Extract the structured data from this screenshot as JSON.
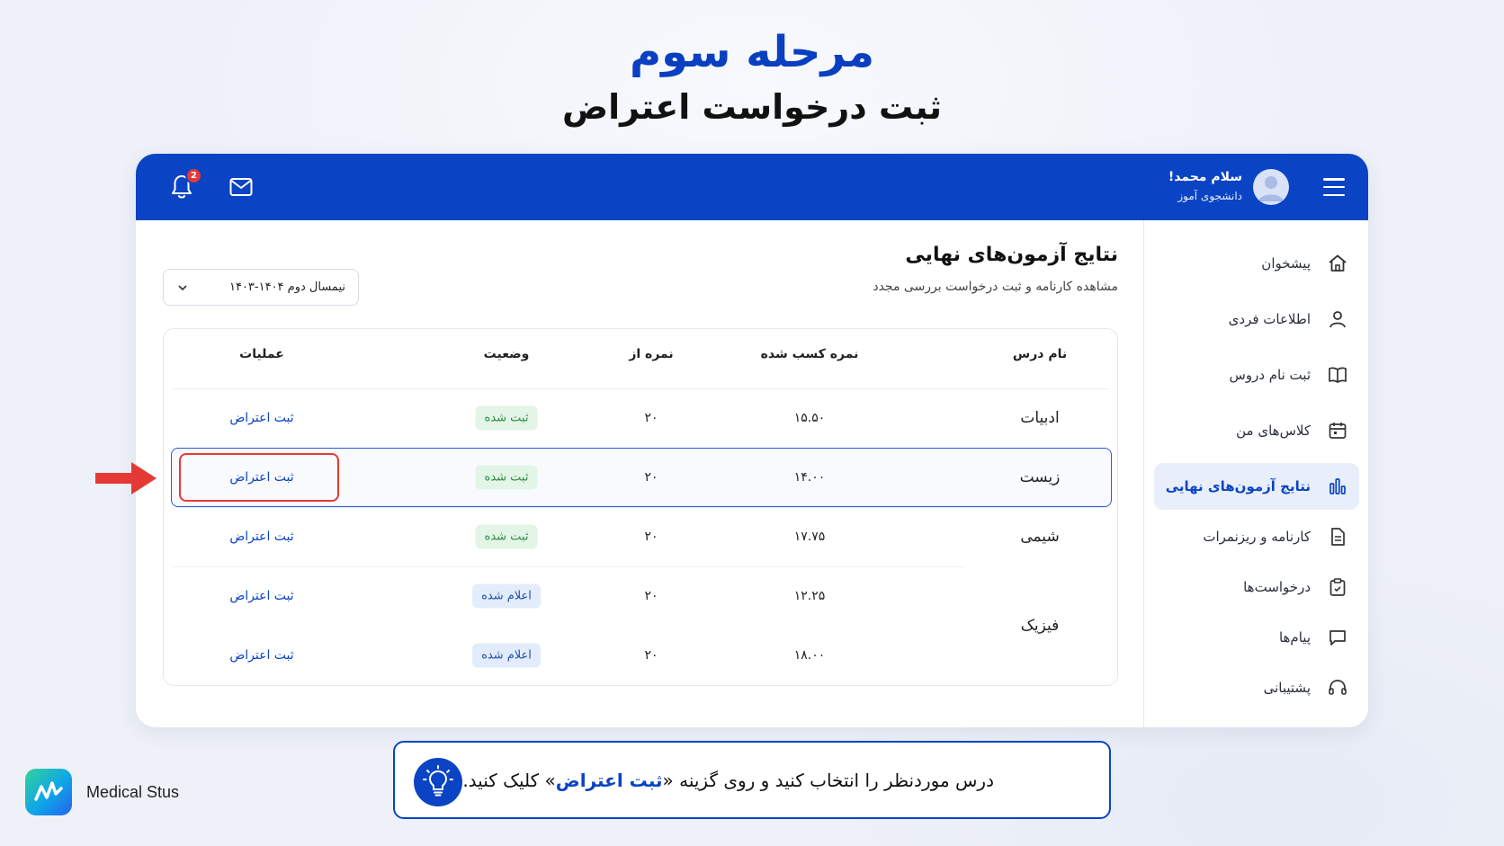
{
  "heading": {
    "stage": "مرحله سوم",
    "title": "ثبت درخواست اعتراض"
  },
  "topbar": {
    "greeting": "سلام محمد!",
    "role": "دانشجوی آموز",
    "notification_count": "2"
  },
  "sidebar": {
    "items": [
      {
        "label": "پیشخوان",
        "icon": "home-icon"
      },
      {
        "label": "اطلاعات فردی",
        "icon": "user-icon"
      },
      {
        "label": "ثبت نام دروس",
        "icon": "book-icon"
      },
      {
        "label": "کلاس‌های من",
        "icon": "calendar-icon"
      },
      {
        "label": "نتایج آزمون‌های نهایی",
        "icon": "bar-chart-icon",
        "active": true
      },
      {
        "label": "کارنامه و ریزنمرات",
        "icon": "document-icon"
      },
      {
        "label": "درخواست‌ها",
        "icon": "clipboard-icon"
      },
      {
        "label": "پیام‌ها",
        "icon": "chat-icon"
      },
      {
        "label": "پشتیبانی",
        "icon": "headset-icon"
      }
    ]
  },
  "main": {
    "title": "نتایج آزمون‌های نهایی",
    "subtitle": "مشاهده کارنامه و ثبت درخواست بررسی مجدد",
    "term_select": "نیمسال دوم ۱۴۰۴-۱۴۰۳"
  },
  "table": {
    "headers": {
      "course": "نام درس",
      "earned": "نمره کسب شده",
      "out_of": "نمره از",
      "status": "وضعیت",
      "operations": "عملیات"
    },
    "rows": [
      {
        "course": "ادبیات",
        "earned": "۱۵.۵۰",
        "out_of": "۲۰",
        "status": "ثبت شده",
        "status_type": "green",
        "action": "ثبت اعتراض"
      },
      {
        "course": "زیست",
        "earned": "۱۴.۰۰",
        "out_of": "۲۰",
        "status": "ثبت شده",
        "status_type": "green",
        "action": "ثبت اعتراض",
        "highlighted": true
      },
      {
        "course": "شیمی",
        "earned": "۱۷.۷۵",
        "out_of": "۲۰",
        "status": "ثبت شده",
        "status_type": "green",
        "action": "ثبت اعتراض"
      },
      {
        "course": "فیزیک",
        "earned": "۱۲.۲۵",
        "out_of": "۲۰",
        "status": "اعلام شده",
        "status_type": "blue",
        "action": "ثبت اعتراض"
      },
      {
        "course": "",
        "earned": "۱۸.۰۰",
        "out_of": "۲۰",
        "status": "اعلام شده",
        "status_type": "blue",
        "action": "ثبت اعتراض"
      }
    ]
  },
  "tip": {
    "before": "درس موردنظر را انتخاب کنید و روی گزینه «",
    "highlight": "ثبت اعتراض",
    "after": "» کلیک کنید."
  },
  "brand": {
    "name": "Medical Stus"
  },
  "colors": {
    "primary": "#0a44c4",
    "accent_red": "#e53935",
    "badge_green": "#2e8a45",
    "badge_blue": "#1e4fb8"
  }
}
